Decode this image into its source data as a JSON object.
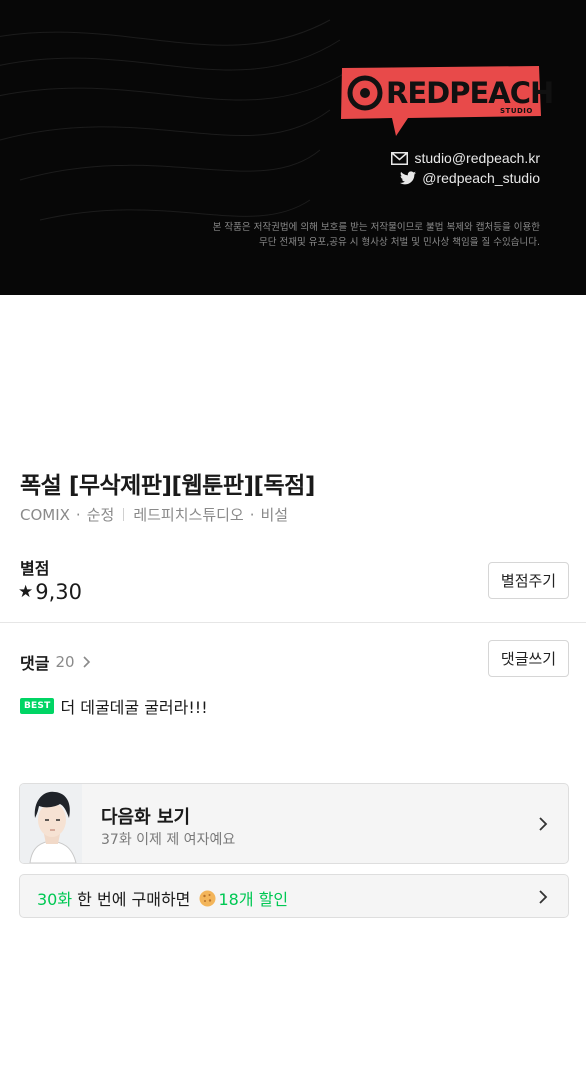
{
  "banner": {
    "logo_text": "REDPEACH",
    "logo_subtext": "STUDIO",
    "email": "studio@redpeach.kr",
    "twitter": "@redpeach_studio",
    "copyright_line1": "본 작품은 저작권법에 의해 보호를 받는 저작물이므로 불법 복제와 캡처등을 이용한",
    "copyright_line2": "무단 전재및 유포,공유 시 형사상 처벌 및 민사상 책임을 질 수있습니다.",
    "colors": {
      "logo_red": "#e84a4a",
      "background": "#070707"
    }
  },
  "work": {
    "title": "폭설 [무삭제판][웹툰판][독점]",
    "label": "COMIX",
    "genre": "순정",
    "author": "레드피치스튜디오",
    "rating_tag": "비설"
  },
  "rating": {
    "label": "별점",
    "star": "★",
    "value": "9,30",
    "button": "별점주기"
  },
  "comments": {
    "label": "댓글",
    "count": "20",
    "button": "댓글쓰기",
    "best_badge": "BEST",
    "best_comment": "더 데굴데굴 굴러라!!!"
  },
  "next_episode": {
    "title": "다음화 보기",
    "subtitle": "37화 이제 제 여자예요"
  },
  "promo": {
    "episodes": "30화",
    "middle": " 한 번에 구매하면 ",
    "discount": "18개 할인",
    "accent_color": "#00c853"
  }
}
